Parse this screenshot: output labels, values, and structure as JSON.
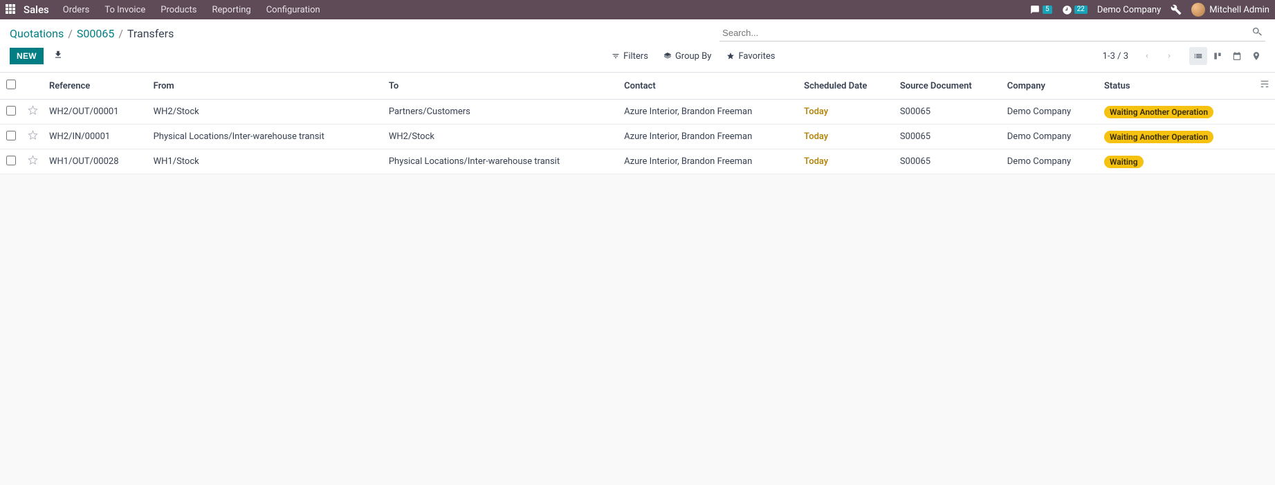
{
  "nav": {
    "brand": "Sales",
    "menu": [
      "Orders",
      "To Invoice",
      "Products",
      "Reporting",
      "Configuration"
    ],
    "messages_badge": "5",
    "activities_badge": "22",
    "company": "Demo Company",
    "user": "Mitchell Admin"
  },
  "breadcrumb": {
    "items": [
      "Quotations",
      "S00065"
    ],
    "current": "Transfers"
  },
  "actions": {
    "new_label": "NEW"
  },
  "search": {
    "placeholder": "Search..."
  },
  "toolbar": {
    "filters": "Filters",
    "group_by": "Group By",
    "favorites": "Favorites",
    "pager": "1-3 / 3"
  },
  "table": {
    "headers": {
      "reference": "Reference",
      "from": "From",
      "to": "To",
      "contact": "Contact",
      "scheduled_date": "Scheduled Date",
      "source_document": "Source Document",
      "company": "Company",
      "status": "Status"
    },
    "rows": [
      {
        "reference": "WH2/OUT/00001",
        "from": "WH2/Stock",
        "to": "Partners/Customers",
        "contact": "Azure Interior, Brandon Freeman",
        "scheduled_date": "Today",
        "source_document": "S00065",
        "company": "Demo Company",
        "status": "Waiting Another Operation"
      },
      {
        "reference": "WH2/IN/00001",
        "from": "Physical Locations/Inter-warehouse transit",
        "to": "WH2/Stock",
        "contact": "Azure Interior, Brandon Freeman",
        "scheduled_date": "Today",
        "source_document": "S00065",
        "company": "Demo Company",
        "status": "Waiting Another Operation"
      },
      {
        "reference": "WH1/OUT/00028",
        "from": "WH1/Stock",
        "to": "Physical Locations/Inter-warehouse transit",
        "contact": "Azure Interior, Brandon Freeman",
        "scheduled_date": "Today",
        "source_document": "S00065",
        "company": "Demo Company",
        "status": "Waiting"
      }
    ]
  }
}
